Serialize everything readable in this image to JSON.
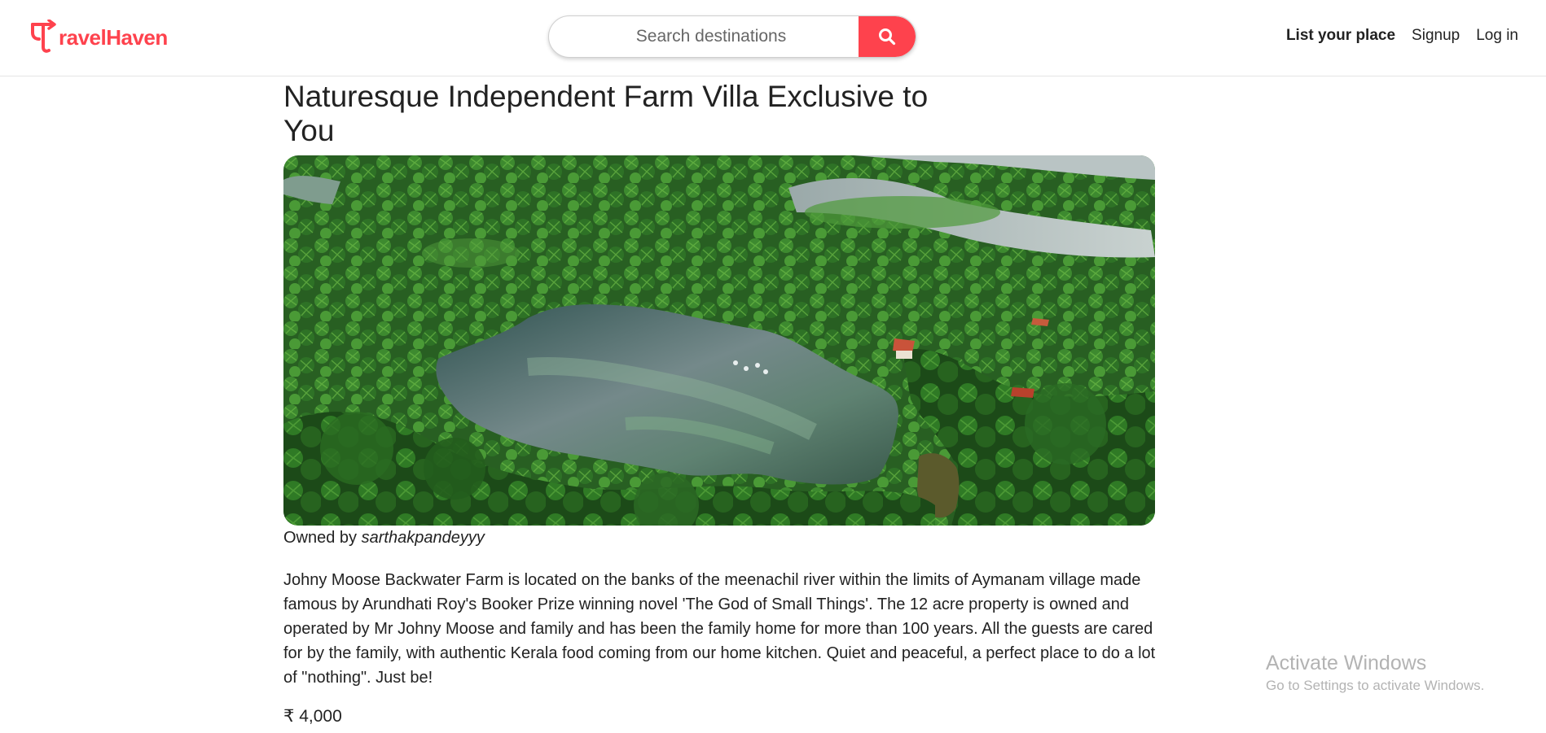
{
  "colors": {
    "brand": "#fe424d",
    "text": "#222222",
    "border": "#e4e4e4"
  },
  "header": {
    "brand": {
      "name": "TravelHaven",
      "display_text": "ravelHaven",
      "icon": "compass-arrow-icon"
    },
    "search": {
      "placeholder": "Search destinations",
      "button_icon": "search-icon"
    },
    "nav": {
      "list_place": "List your place",
      "signup": "Signup",
      "login": "Log in"
    }
  },
  "listing": {
    "title": "Naturesque Independent Farm Villa Exclusive to You",
    "image_alt": "Aerial view of a lake surrounded by coconut palms",
    "owner_prefix": "Owned by",
    "owner_name": "sarthakpandeyyy",
    "description": "Johny Moose Backwater Farm is located on the banks of the meenachil river within the limits of Aymanam village made famous by Arundhati Roy's Booker Prize winning novel 'The God of Small Things'. The 12 acre property is owned and operated by Mr Johny Moose and family and has been the family home for more than 100 years. All the guests are cared for by the family, with authentic Kerala food coming from our home kitchen. Quiet and peaceful, a perfect place to do a lot of \"nothing\". Just be!",
    "price": "₹ 4,000"
  },
  "watermark": {
    "title": "Activate Windows",
    "subtitle": "Go to Settings to activate Windows."
  }
}
